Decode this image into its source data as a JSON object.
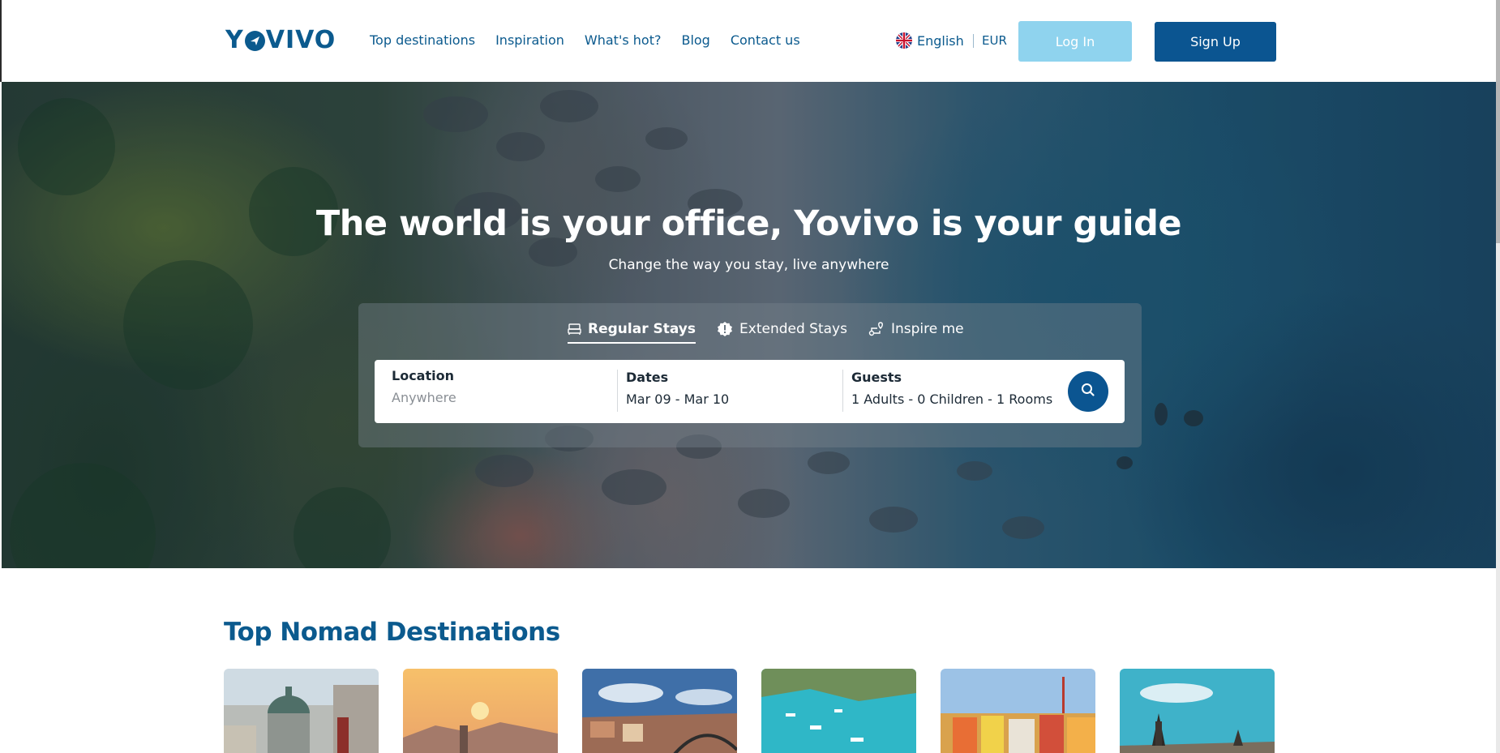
{
  "brand": {
    "logo_text_left": "Y",
    "logo_text_right": "VIVO"
  },
  "nav": {
    "items": [
      "Top destinations",
      "Inspiration",
      "What's hot?",
      "Blog",
      "Contact us"
    ]
  },
  "header": {
    "language": "English",
    "currency": "EUR",
    "login_label": "Log In",
    "signup_label": "Sign Up"
  },
  "hero": {
    "title": "The world is your office, Yovivo is your guide",
    "subtitle": "Change the way you stay, live anywhere"
  },
  "search": {
    "tabs": [
      {
        "label": "Regular Stays",
        "icon": "bed-icon",
        "active": true
      },
      {
        "label": "Extended Stays",
        "icon": "badge-alert-icon",
        "active": false
      },
      {
        "label": "Inspire me",
        "icon": "route-icon",
        "active": false
      }
    ],
    "location": {
      "label": "Location",
      "placeholder": "Anywhere"
    },
    "dates": {
      "label": "Dates",
      "value": "Mar 09 - Mar 10"
    },
    "guests": {
      "label": "Guests",
      "value": "1 Adults - 0 Children - 1 Rooms"
    }
  },
  "destinations": {
    "title": "Top Nomad Destinations"
  },
  "colors": {
    "brand": "#0b5a8e",
    "signup": "#0b5591",
    "login": "#8fd3ee"
  }
}
